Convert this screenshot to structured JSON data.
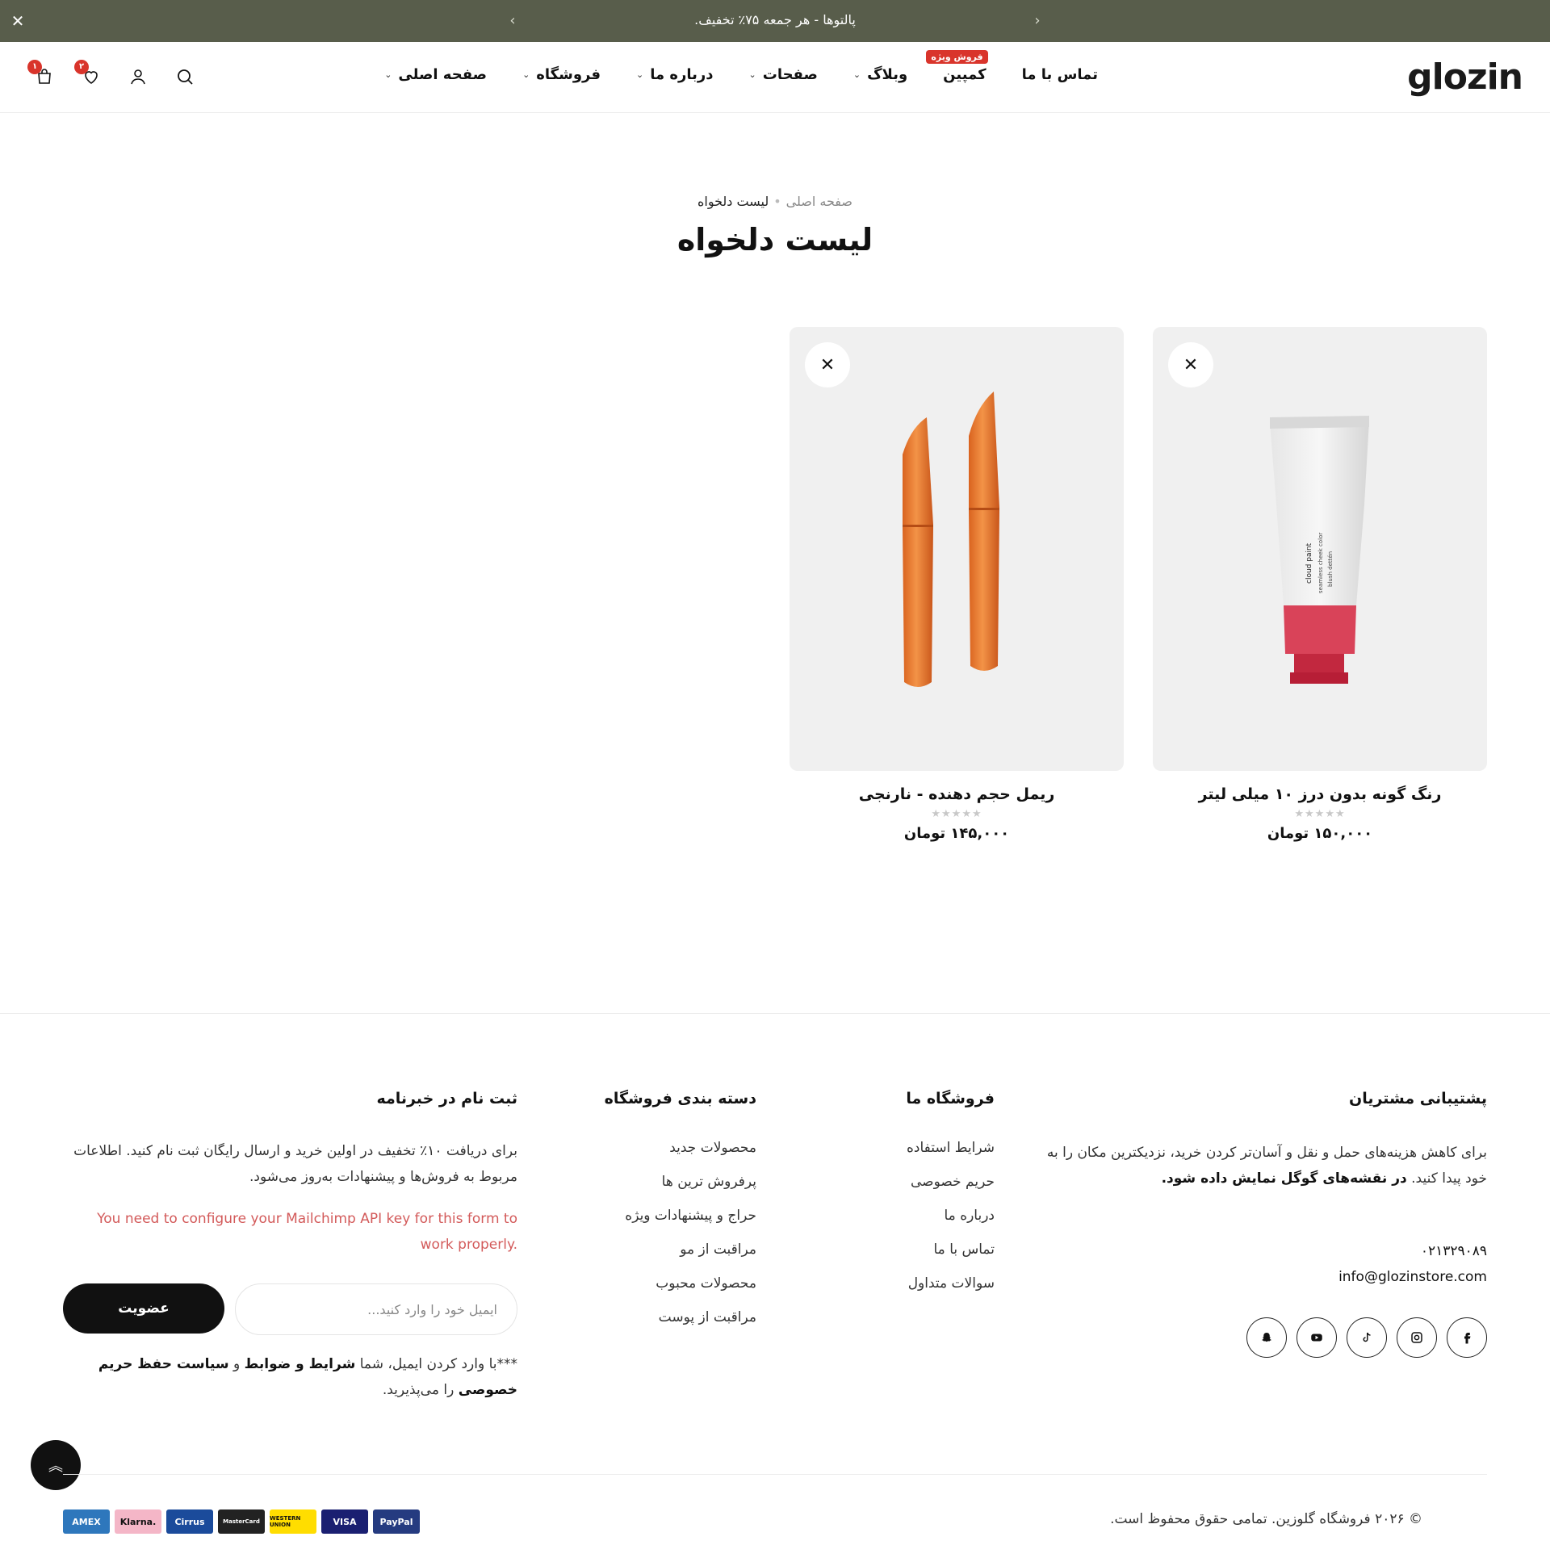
{
  "announcement": {
    "text": "پالتوها - هر جمعه ۷۵٪ تخفیف.",
    "close": "✕",
    "prev": "‹",
    "next": "›"
  },
  "header": {
    "logo": "glozin",
    "nav": [
      {
        "label": "صفحه اصلی",
        "has_dropdown": true
      },
      {
        "label": "فروشگاه",
        "has_dropdown": true
      },
      {
        "label": "درباره ما",
        "has_dropdown": true
      },
      {
        "label": "صفحات",
        "has_dropdown": true
      },
      {
        "label": "وبلاگ",
        "has_dropdown": true
      },
      {
        "label": "کمپین",
        "has_dropdown": false,
        "badge": "فروش ویژه"
      },
      {
        "label": "تماس با ما",
        "has_dropdown": false
      }
    ],
    "wishlist_count": "۲",
    "cart_count": "۱",
    "icons": [
      "search-icon",
      "user-icon",
      "heart-icon",
      "cart-icon"
    ]
  },
  "breadcrumb": {
    "home": "صفحه اصلی",
    "current": "لیست دلخواه"
  },
  "page_title": "لیست دلخواه",
  "products": [
    {
      "name": "رنگ گونه بدون درز ۱۰ میلی لیتر",
      "price": "۱۵۰,۰۰۰ تومان",
      "stars": "★★★★★",
      "image_desc": "cheek-tint-tube"
    },
    {
      "name": "ریمل حجم دهنده - نارنجی",
      "price": "۱۴۵,۰۰۰ تومان",
      "stars": "★★★★★",
      "image_desc": "orange-mascara"
    }
  ],
  "footer": {
    "support": {
      "title": "پشتیبانی مشتریان",
      "text": "برای کاهش هزینه‌های حمل و نقل و آسان‌تر کردن خرید، نزدیکترین مکان را به خود پیدا کنید.",
      "text_bold": "در نقشه‌های گوگل نمایش داده شود.",
      "phone": "۰۲۱۳۲۹۰۸۹",
      "email": "info@glozinstore.com",
      "socials": [
        "facebook-icon",
        "instagram-icon",
        "tiktok-icon",
        "youtube-icon",
        "snapchat-icon"
      ]
    },
    "store": {
      "title": "فروشگاه ما",
      "links": [
        "شرایط استفاده",
        "حریم خصوصی",
        "درباره ما",
        "تماس با ما",
        "سوالات متداول"
      ]
    },
    "categories": {
      "title": "دسته بندی فروشگاه",
      "links": [
        "محصولات جدید",
        "پرفروش ترین ها",
        "حراج و پیشنهادات ویژه",
        "مراقبت از مو",
        "محصولات محبوب",
        "مراقبت از پوست"
      ]
    },
    "newsletter": {
      "title": "ثبت نام در خبرنامه",
      "desc": "برای دریافت ۱۰٪ تخفیف در اولین خرید و ارسال رایگان ثبت نام کنید. اطلاعات مربوط به فروش‌ها و پیشنهادات به‌روز می‌شود.",
      "warning": "You need to configure your Mailchimp API key for this form to work properly.",
      "placeholder": "ایمیل خود را وارد کنید...",
      "button": "عضویت",
      "terms_prefix": "***با وارد کردن ایمیل، شما",
      "terms_link": "شرایط و ضوابط",
      "terms_and": "و",
      "privacy_link": "سیاست حفظ حریم خصوصی",
      "terms_suffix": "را می‌پذیرید."
    },
    "copyright": "© ۲۰۲۶ فروشگاه گلوزین. تمامی حقوق محفوظ است.",
    "payments": [
      {
        "name": "AMEX",
        "bg": "#2e77bc",
        "fg": "#ffffff"
      },
      {
        "name": "Klarna.",
        "bg": "#f4b6c7",
        "fg": "#111111"
      },
      {
        "name": "Cirrus",
        "bg": "#1b4b9b",
        "fg": "#ffffff"
      },
      {
        "name": "MasterCard",
        "bg": "#222222",
        "fg": "#ffffff"
      },
      {
        "name": "WESTERN UNION",
        "bg": "#ffdd00",
        "fg": "#111111"
      },
      {
        "name": "VISA",
        "bg": "#1a1f71",
        "fg": "#ffffff"
      },
      {
        "name": "PayPal",
        "bg": "#253b80",
        "fg": "#ffffff"
      }
    ]
  },
  "colors": {
    "topbar": "#585d4b",
    "accent_red": "#d9342b",
    "warning": "#d35a5a"
  }
}
